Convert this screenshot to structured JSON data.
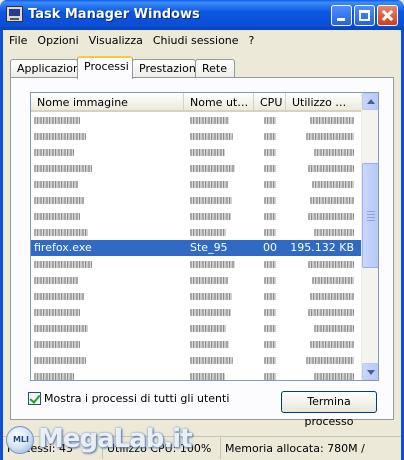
{
  "window": {
    "title": "Task Manager Windows",
    "icon": "task-manager-icon"
  },
  "menu": [
    "File",
    "Opzioni",
    "Visualizza",
    "Chiudi sessione",
    "?"
  ],
  "tabs": [
    {
      "label": "Applicazioni",
      "active": false
    },
    {
      "label": "Processi",
      "active": true
    },
    {
      "label": "Prestazioni",
      "active": false
    },
    {
      "label": "Rete",
      "active": false
    }
  ],
  "table": {
    "columns": [
      "Nome immagine",
      "Nome ut…",
      "CPU",
      "Utilizzo …"
    ],
    "selected_row": {
      "name": "firefox.exe",
      "user": "Ste_95",
      "cpu": "00",
      "mem": "195.132 KB"
    },
    "blurred_rows_before": 8,
    "blurred_rows_after": 9
  },
  "show_all_checkbox": {
    "label": "Mostra i processi di tutti gli utenti",
    "checked": true
  },
  "terminate_button": "Termina processo",
  "statusbar": {
    "processes": "Processi: 43",
    "cpu": "Utilizzo CPU: 100%",
    "memory": "Memoria allocata: 780M /"
  },
  "watermark": {
    "text": "MegaLab.it",
    "badge": "MLI"
  },
  "colors": {
    "titlebar": "#0b57e3",
    "selection": "#316ac5",
    "background": "#ece9d8"
  }
}
